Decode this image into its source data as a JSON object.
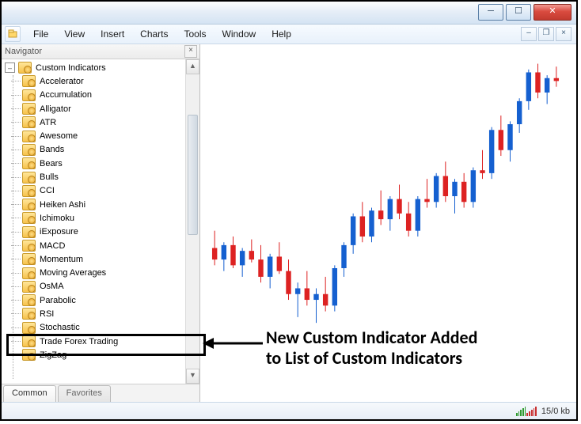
{
  "menu": {
    "items": [
      "File",
      "View",
      "Insert",
      "Charts",
      "Tools",
      "Window",
      "Help"
    ]
  },
  "navigator": {
    "title": "Navigator",
    "root": "Custom Indicators",
    "items": [
      "Accelerator",
      "Accumulation",
      "Alligator",
      "ATR",
      "Awesome",
      "Bands",
      "Bears",
      "Bulls",
      "CCI",
      "Heiken Ashi",
      "Ichimoku",
      "iExposure",
      "MACD",
      "Momentum",
      "Moving Averages",
      "OsMA",
      "Parabolic",
      "RSI",
      "Stochastic",
      "Trade Forex Trading",
      "ZigZag"
    ],
    "tabs": {
      "common": "Common",
      "favorites": "Favorites"
    }
  },
  "status": {
    "net": "15/0 kb"
  },
  "annotation": {
    "text1": "New Custom Indicator Added",
    "text2": "to List of Custom Indicators"
  },
  "chart_data": {
    "type": "candlestick",
    "note": "Axes and values not labeled in screenshot; positions estimated from pixels. o/h/l/c on 0-100 relative scale; color up=blue, down=red.",
    "ylim": [
      0,
      100
    ],
    "candles": [
      {
        "x": 0,
        "o": 32,
        "h": 38,
        "l": 26,
        "c": 28,
        "color": "red"
      },
      {
        "x": 1,
        "o": 28,
        "h": 34,
        "l": 24,
        "c": 33,
        "color": "blue"
      },
      {
        "x": 2,
        "o": 33,
        "h": 36,
        "l": 25,
        "c": 26,
        "color": "red"
      },
      {
        "x": 3,
        "o": 26,
        "h": 32,
        "l": 22,
        "c": 31,
        "color": "blue"
      },
      {
        "x": 4,
        "o": 31,
        "h": 35,
        "l": 27,
        "c": 28,
        "color": "red"
      },
      {
        "x": 5,
        "o": 28,
        "h": 33,
        "l": 20,
        "c": 22,
        "color": "red"
      },
      {
        "x": 6,
        "o": 22,
        "h": 30,
        "l": 18,
        "c": 29,
        "color": "blue"
      },
      {
        "x": 7,
        "o": 29,
        "h": 34,
        "l": 23,
        "c": 24,
        "color": "red"
      },
      {
        "x": 8,
        "o": 24,
        "h": 28,
        "l": 14,
        "c": 16,
        "color": "red"
      },
      {
        "x": 9,
        "o": 16,
        "h": 20,
        "l": 8,
        "c": 18,
        "color": "blue"
      },
      {
        "x": 10,
        "o": 18,
        "h": 24,
        "l": 12,
        "c": 14,
        "color": "red"
      },
      {
        "x": 11,
        "o": 14,
        "h": 18,
        "l": 6,
        "c": 16,
        "color": "blue"
      },
      {
        "x": 12,
        "o": 16,
        "h": 22,
        "l": 10,
        "c": 12,
        "color": "red"
      },
      {
        "x": 13,
        "o": 12,
        "h": 26,
        "l": 10,
        "c": 25,
        "color": "blue"
      },
      {
        "x": 14,
        "o": 25,
        "h": 34,
        "l": 22,
        "c": 33,
        "color": "blue"
      },
      {
        "x": 15,
        "o": 33,
        "h": 44,
        "l": 30,
        "c": 43,
        "color": "blue"
      },
      {
        "x": 16,
        "o": 43,
        "h": 48,
        "l": 34,
        "c": 36,
        "color": "red"
      },
      {
        "x": 17,
        "o": 36,
        "h": 46,
        "l": 34,
        "c": 45,
        "color": "blue"
      },
      {
        "x": 18,
        "o": 45,
        "h": 52,
        "l": 40,
        "c": 42,
        "color": "red"
      },
      {
        "x": 19,
        "o": 42,
        "h": 50,
        "l": 38,
        "c": 49,
        "color": "blue"
      },
      {
        "x": 20,
        "o": 49,
        "h": 54,
        "l": 42,
        "c": 44,
        "color": "red"
      },
      {
        "x": 21,
        "o": 44,
        "h": 48,
        "l": 36,
        "c": 38,
        "color": "red"
      },
      {
        "x": 22,
        "o": 38,
        "h": 50,
        "l": 36,
        "c": 49,
        "color": "blue"
      },
      {
        "x": 23,
        "o": 49,
        "h": 56,
        "l": 46,
        "c": 48,
        "color": "red"
      },
      {
        "x": 24,
        "o": 48,
        "h": 58,
        "l": 46,
        "c": 57,
        "color": "blue"
      },
      {
        "x": 25,
        "o": 57,
        "h": 62,
        "l": 48,
        "c": 50,
        "color": "red"
      },
      {
        "x": 26,
        "o": 50,
        "h": 56,
        "l": 44,
        "c": 55,
        "color": "blue"
      },
      {
        "x": 27,
        "o": 55,
        "h": 58,
        "l": 46,
        "c": 48,
        "color": "red"
      },
      {
        "x": 28,
        "o": 48,
        "h": 60,
        "l": 46,
        "c": 59,
        "color": "blue"
      },
      {
        "x": 29,
        "o": 59,
        "h": 66,
        "l": 56,
        "c": 58,
        "color": "red"
      },
      {
        "x": 30,
        "o": 58,
        "h": 74,
        "l": 56,
        "c": 73,
        "color": "blue"
      },
      {
        "x": 31,
        "o": 73,
        "h": 78,
        "l": 64,
        "c": 66,
        "color": "red"
      },
      {
        "x": 32,
        "o": 66,
        "h": 76,
        "l": 62,
        "c": 75,
        "color": "blue"
      },
      {
        "x": 33,
        "o": 75,
        "h": 84,
        "l": 72,
        "c": 83,
        "color": "blue"
      },
      {
        "x": 34,
        "o": 83,
        "h": 94,
        "l": 80,
        "c": 93,
        "color": "blue"
      },
      {
        "x": 35,
        "o": 93,
        "h": 96,
        "l": 84,
        "c": 86,
        "color": "red"
      },
      {
        "x": 36,
        "o": 86,
        "h": 92,
        "l": 82,
        "c": 91,
        "color": "blue"
      },
      {
        "x": 37,
        "o": 91,
        "h": 95,
        "l": 88,
        "c": 90,
        "color": "red"
      }
    ]
  }
}
